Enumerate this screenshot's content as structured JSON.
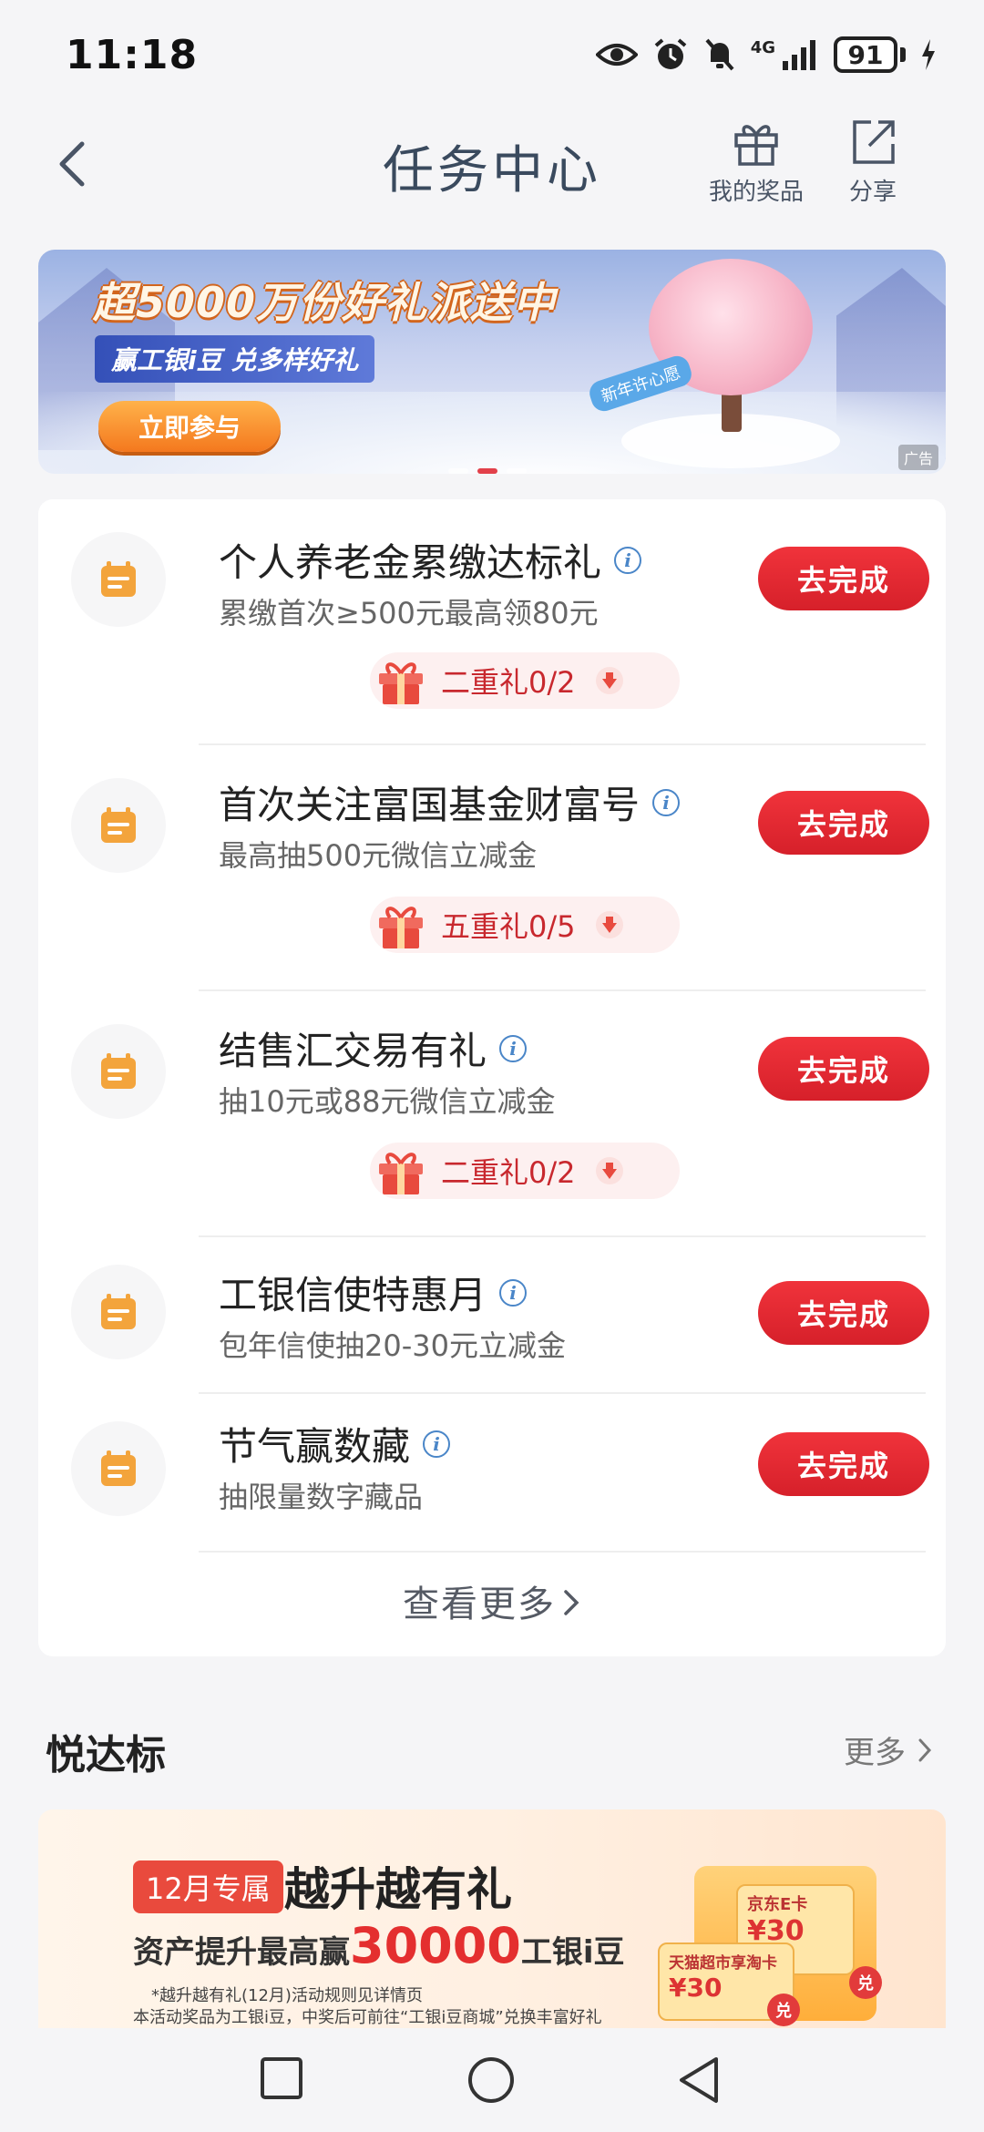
{
  "status_bar": {
    "time": "11:18",
    "network": "4G",
    "battery": "91"
  },
  "header": {
    "title": "任务中心",
    "my_prizes_label": "我的奖品",
    "share_label": "分享"
  },
  "banner": {
    "title": "超5000万份好礼派送中",
    "subtitle": "赢工银i豆 兑多样好礼",
    "cta": "立即参与",
    "tag": "新年许心愿",
    "ad_label": "广告"
  },
  "tasks": [
    {
      "title": "个人养老金累缴达标礼",
      "desc": "累缴首次≥500元最高领80元",
      "button": "去完成",
      "gift": "二重礼0/2"
    },
    {
      "title": "首次关注富国基金财富号",
      "desc": "最高抽500元微信立减金",
      "button": "去完成",
      "gift": "五重礼0/5"
    },
    {
      "title": "结售汇交易有礼",
      "desc": "抽10元或88元微信立减金",
      "button": "去完成",
      "gift": "二重礼0/2"
    },
    {
      "title": "工银信使特惠月",
      "desc": "包年信使抽20-30元立减金",
      "button": "去完成"
    },
    {
      "title": "节气赢数藏",
      "desc": "抽限量数字藏品",
      "button": "去完成"
    }
  ],
  "see_more": "查看更多",
  "section": {
    "title": "悦达标",
    "more": "更多"
  },
  "promo": {
    "tag": "12月专属",
    "headline": "越升越有礼",
    "line_prefix": "资产提升最高赢",
    "line_amount": "30000",
    "line_suffix": "工银i豆",
    "note1": "*越升越有礼(12月)活动规则见详情页",
    "note2": "本活动奖品为工银i豆，中奖后可前往“工银i豆商城”兑换丰富好礼",
    "card1_label": "京东E卡",
    "card1_value": "¥30",
    "card2_label": "天猫超市享淘卡",
    "card2_value": "¥30",
    "coin_label": "兑"
  },
  "icons": {
    "task_icon": "calendar-icon",
    "gift_icon": "gift-icon",
    "accent": "#e32830",
    "task_icon_color": "#f3a43c"
  }
}
